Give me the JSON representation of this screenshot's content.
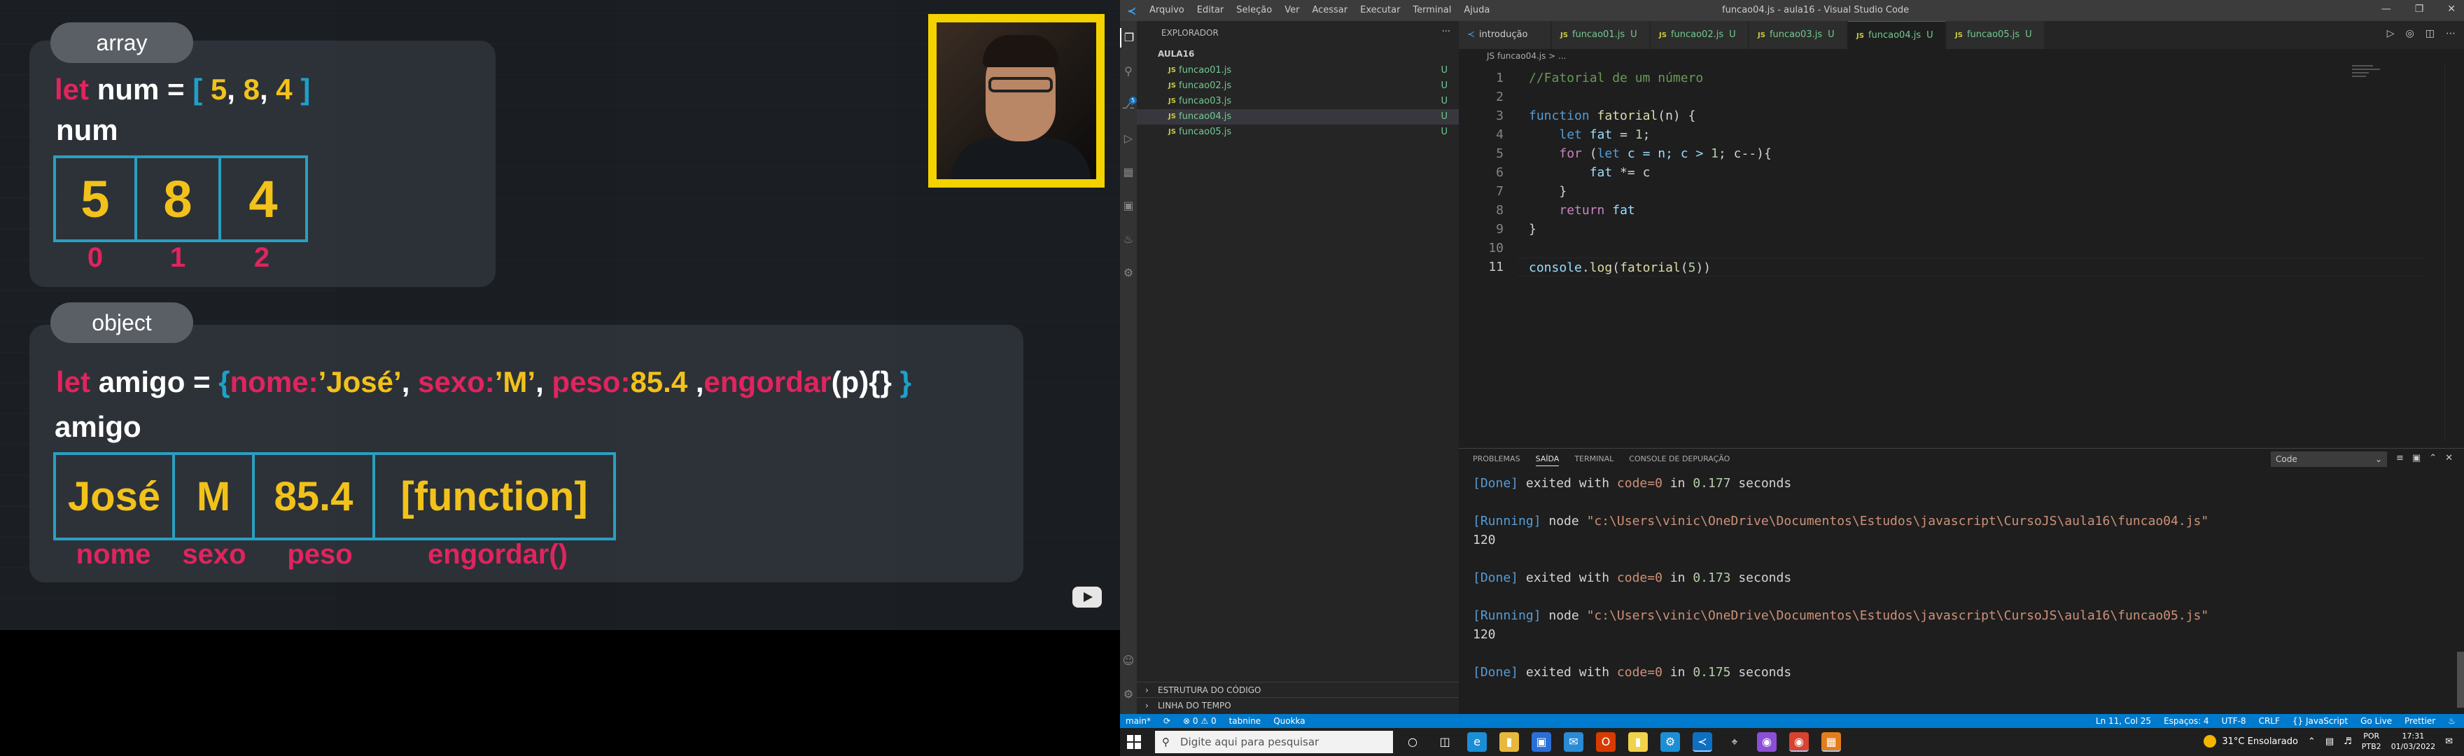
{
  "lesson": {
    "array_section": {
      "pill": "array",
      "code": {
        "kw": "let",
        "name": "num",
        "eq": "=",
        "open": "[",
        "v1": "5",
        "c1": ",",
        "v2": "8",
        "c2": ",",
        "v3": "4",
        "close": "]"
      },
      "var_label": "num",
      "cells": [
        "5",
        "8",
        "4"
      ],
      "indices": [
        "0",
        "1",
        "2"
      ]
    },
    "object_section": {
      "pill": "object",
      "code": {
        "kw": "let",
        "name": "amigo",
        "eq": "=",
        "open": "{",
        "k1": "nome:",
        "v1": "’José’",
        "c1": ",",
        "k2": "sexo:",
        "v2": "’M’",
        "c2": ",",
        "k3": "peso:",
        "v3": "85.4",
        "c3": ",",
        "k4": "engordar",
        "v4": "(p){}",
        "close": "}"
      },
      "var_label": "amigo",
      "cells": [
        "José",
        "M",
        "85.4",
        "[function]"
      ],
      "keys": [
        "nome",
        "sexo",
        "peso",
        "engordar()"
      ]
    }
  },
  "vscode": {
    "titlebar": {
      "menu": [
        "Arquivo",
        "Editar",
        "Seleção",
        "Ver",
        "Acessar",
        "Executar",
        "Terminal",
        "Ajuda"
      ],
      "title": "funcao04.js - aula16 - Visual Studio Code"
    },
    "explorer": {
      "header": "EXPLORADOR",
      "more": "···",
      "folder": "AULA16",
      "files": [
        {
          "name": "funcao01.js",
          "status": "U"
        },
        {
          "name": "funcao02.js",
          "status": "U"
        },
        {
          "name": "funcao03.js",
          "status": "U"
        },
        {
          "name": "funcao04.js",
          "status": "U"
        },
        {
          "name": "funcao05.js",
          "status": "U"
        }
      ],
      "sections": [
        "ESTRUTURA DO CÓDIGO",
        "LINHA DO TEMPO"
      ]
    },
    "tabs": [
      {
        "label": "introdução",
        "status": ""
      },
      {
        "label": "funcao01.js",
        "status": "U"
      },
      {
        "label": "funcao02.js",
        "status": "U"
      },
      {
        "label": "funcao03.js",
        "status": "U"
      },
      {
        "label": "funcao04.js",
        "status": "U"
      },
      {
        "label": "funcao05.js",
        "status": "U"
      }
    ],
    "js_badge": "JS",
    "breadcrumb": "JS funcao04.js > ...",
    "editor": {
      "line_numbers": [
        "1",
        "2",
        "3",
        "4",
        "5",
        "6",
        "7",
        "8",
        "9",
        "10",
        "11"
      ],
      "l1": "//Fatorial de um número",
      "l3_kw": "function",
      "l3_fn": "fatorial",
      "l3_rest": "(n) {",
      "l4_kw": "let",
      "l4_var": "fat",
      "l4_eq": " = ",
      "l4_num": "1",
      "l4_end": ";",
      "l5_kw": "for",
      "l5_a": " (",
      "l5_let": "let",
      "l5_b": " c = n; c > ",
      "l5_num": "1",
      "l5_c": "; c--){",
      "l6_var": "fat",
      "l6_rest": " *= c",
      "l7": "}",
      "l8_kw": "return",
      "l8_var": "fat",
      "l9": "}",
      "l11_obj": "console",
      "l11_dot": ".",
      "l11_fn": "log",
      "l11_a": "(",
      "l11_fn2": "fatorial",
      "l11_b": "(",
      "l11_num": "5",
      "l11_c": "))"
    },
    "panel": {
      "tabs": [
        "PROBLEMAS",
        "SAÍDA",
        "TERMINAL",
        "CONSOLE DE DEPURAÇÃO"
      ],
      "output_channel": "Code",
      "output": {
        "done1": "[Done]",
        "exit1": " exited with ",
        "code1": "code=0",
        "in1": " in ",
        "t1": "0.177",
        "s1": " seconds",
        "run1": "[Running]",
        "cmd1": " node ",
        "path1": "\"c:\\Users\\vinic\\OneDrive\\Documentos\\Estudos\\javascript\\CursoJS\\aula16\\funcao04.js\"",
        "res1": "120",
        "done2": "[Done]",
        "exit2": " exited with ",
        "code2": "code=0",
        "in2": " in ",
        "t2": "0.173",
        "s2": " seconds",
        "run2": "[Running]",
        "cmd2": " node ",
        "path2": "\"c:\\Users\\vinic\\OneDrive\\Documentos\\Estudos\\javascript\\CursoJS\\aula16\\funcao05.js\"",
        "res2": "120",
        "done3": "[Done]",
        "exit3": " exited with ",
        "code3": "code=0",
        "in3": " in ",
        "t3": "0.175",
        "s3": " seconds"
      }
    },
    "statusbar": {
      "left": [
        "main*",
        "⟳",
        "⊗ 0 ⚠ 0",
        "tabnine",
        "Quokka"
      ],
      "right": [
        "Ln 11, Col 25",
        "Espaços: 4",
        "UTF-8",
        "CRLF",
        "{} JavaScript",
        "Go Live",
        "Prettier"
      ]
    }
  },
  "taskbar": {
    "search_placeholder": "Digite aqui para pesquisar",
    "weather": "31°C  Ensolarado",
    "lang": [
      "POR",
      "PTB2"
    ],
    "time": "17:31",
    "date": "01/03/2022"
  },
  "colors": {
    "keyword_red": "#e0245e",
    "value_yellow": "#f2c21b",
    "bracket_blue": "#1ea0c8",
    "vscode_blue": "#007acc"
  }
}
